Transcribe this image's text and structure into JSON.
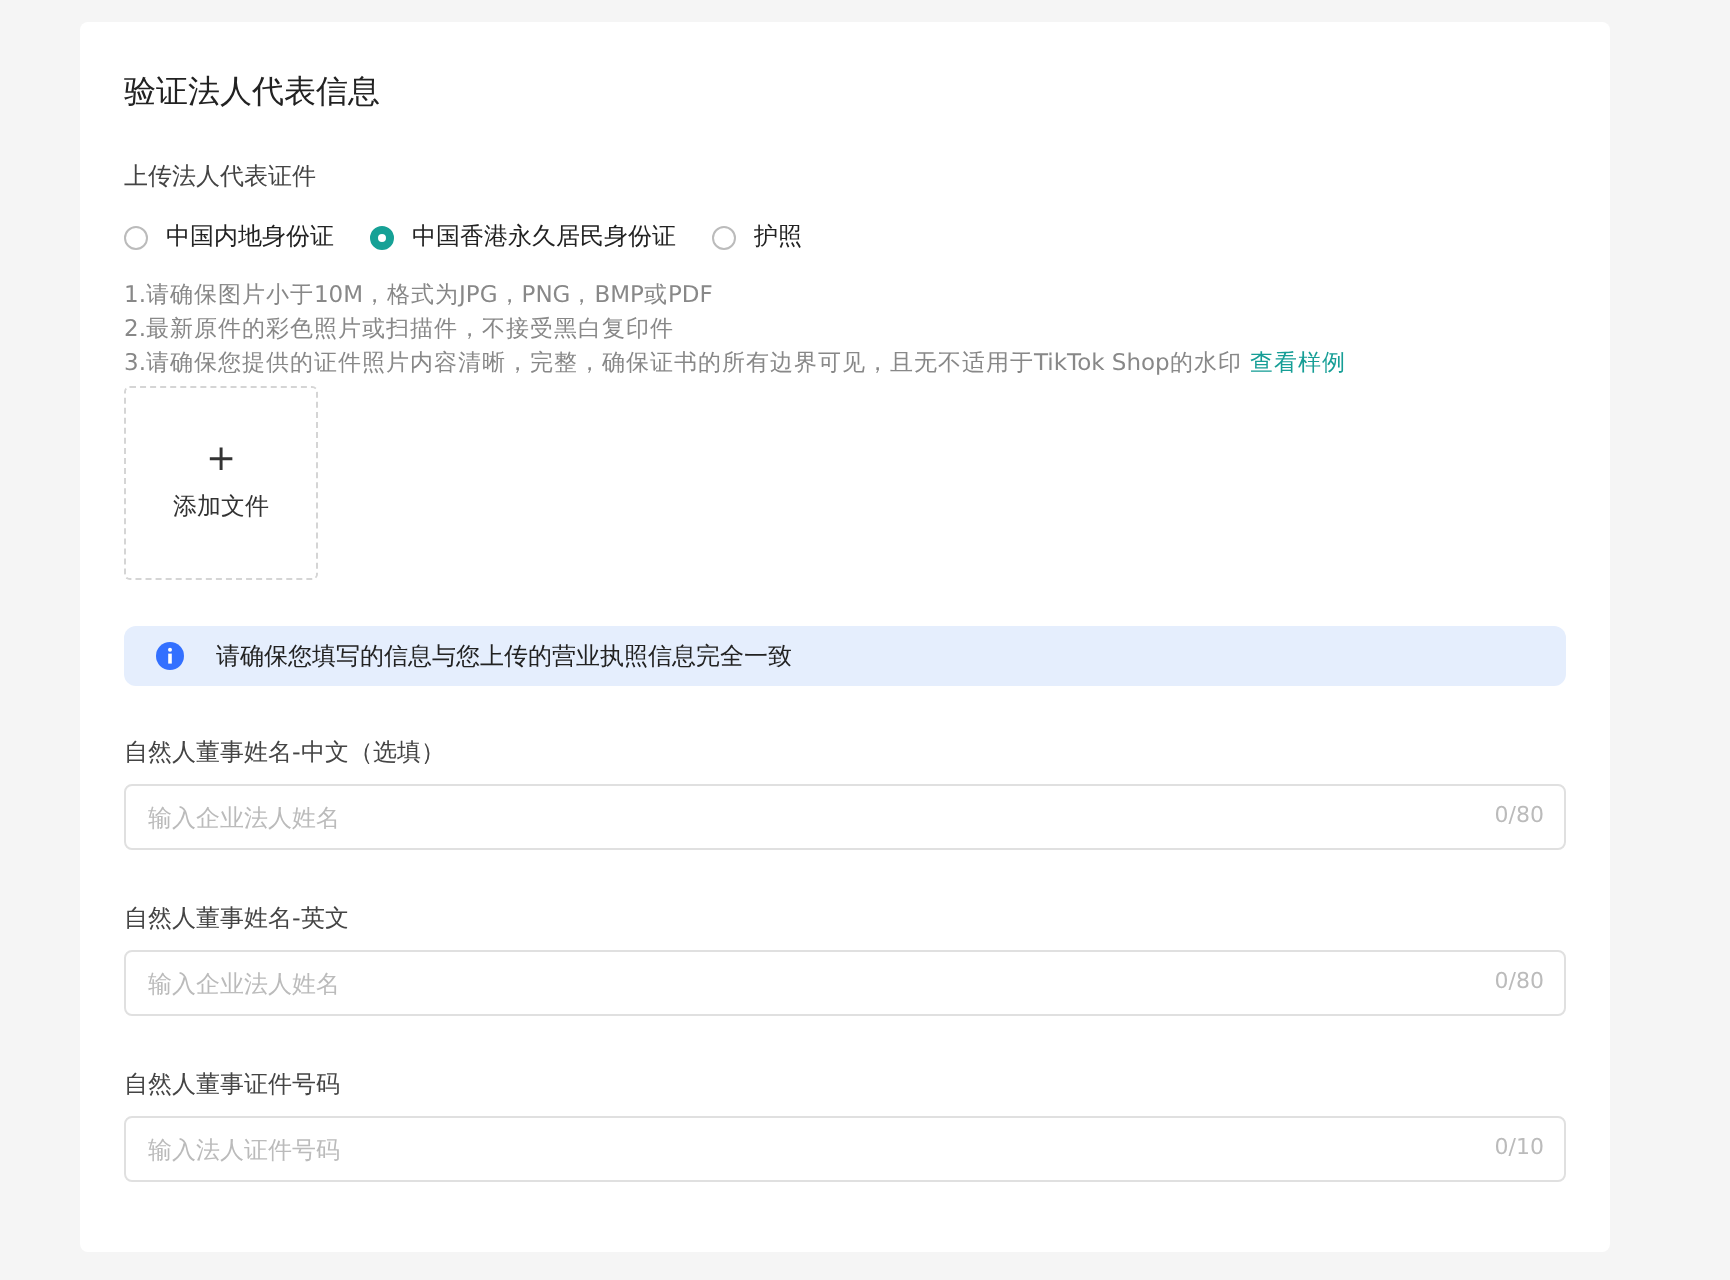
{
  "title": "验证法人代表信息",
  "upload_section": {
    "label": "上传法人代表证件",
    "id_types": [
      {
        "label": "中国内地身份证",
        "selected": false
      },
      {
        "label": "中国香港永久居民身份证",
        "selected": true
      },
      {
        "label": "护照",
        "selected": false
      }
    ],
    "notes": [
      "1.请确保图片小于10M，格式为JPG，PNG，BMP或PDF",
      "2.最新原件的彩色照片或扫描件，不接受黑白复印件",
      "3.请确保您提供的证件照片内容清晰，完整，确保证书的所有边界可见，且无不适用于TikTok Shop的水印"
    ],
    "sample_link": "查看样例",
    "add_file": {
      "icon": "+",
      "label": "添加文件"
    }
  },
  "alert": "请确保您填写的信息与您上传的营业执照信息完全一致",
  "fields": [
    {
      "label": "自然人董事姓名-中文（选填）",
      "placeholder": "输入企业法人姓名",
      "counter": "0/80"
    },
    {
      "label": "自然人董事姓名-英文",
      "placeholder": "输入企业法人姓名",
      "counter": "0/80"
    },
    {
      "label": "自然人董事证件号码",
      "placeholder": "输入法人证件号码",
      "counter": "0/10"
    }
  ]
}
